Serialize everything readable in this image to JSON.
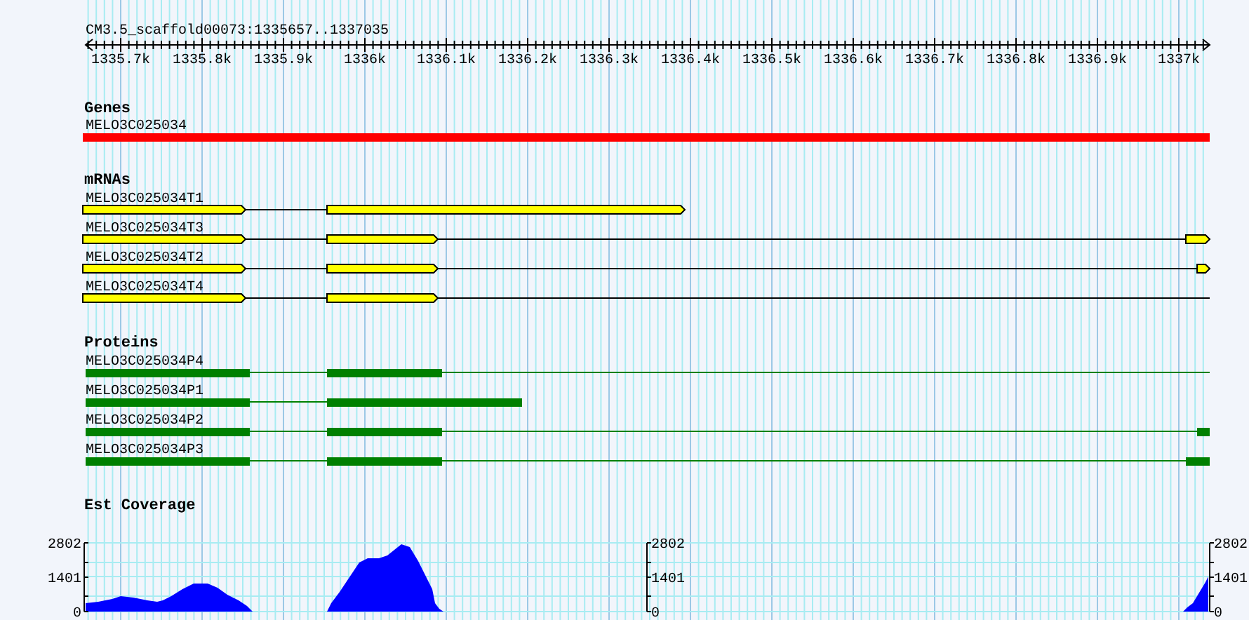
{
  "title": "CM3.5_scaffold00073:1335657..1337035",
  "ruler": {
    "labels": [
      "1335.7k",
      "1335.8k",
      "1335.9k",
      "1336k",
      "1336.1k",
      "1336.2k",
      "1336.3k",
      "1336.4k",
      "1336.5k",
      "1336.6k",
      "1336.7k",
      "1336.8k",
      "1336.9k",
      "1337k"
    ]
  },
  "tracks": [
    {
      "kind": "gene",
      "title": "Genes",
      "features": [
        {
          "name": "MELO3C025034"
        }
      ]
    },
    {
      "kind": "mrna",
      "title": "mRNAs",
      "features": [
        {
          "name": "MELO3C025034T1"
        },
        {
          "name": "MELO3C025034T3"
        },
        {
          "name": "MELO3C025034T2"
        },
        {
          "name": "MELO3C025034T4"
        }
      ]
    },
    {
      "kind": "protein",
      "title": "Proteins",
      "features": [
        {
          "name": "MELO3C025034P4"
        },
        {
          "name": "MELO3C025034P1"
        },
        {
          "name": "MELO3C025034P2"
        },
        {
          "name": "MELO3C025034P3"
        }
      ]
    },
    {
      "kind": "coverage",
      "title": "Est Coverage",
      "axes": [
        {
          "ticks": [
            "2802",
            "1401",
            "0"
          ]
        },
        {
          "ticks": [
            "2802",
            "1401",
            "0"
          ]
        },
        {
          "ticks": [
            "2802",
            "1401",
            "0"
          ]
        }
      ]
    }
  ]
}
